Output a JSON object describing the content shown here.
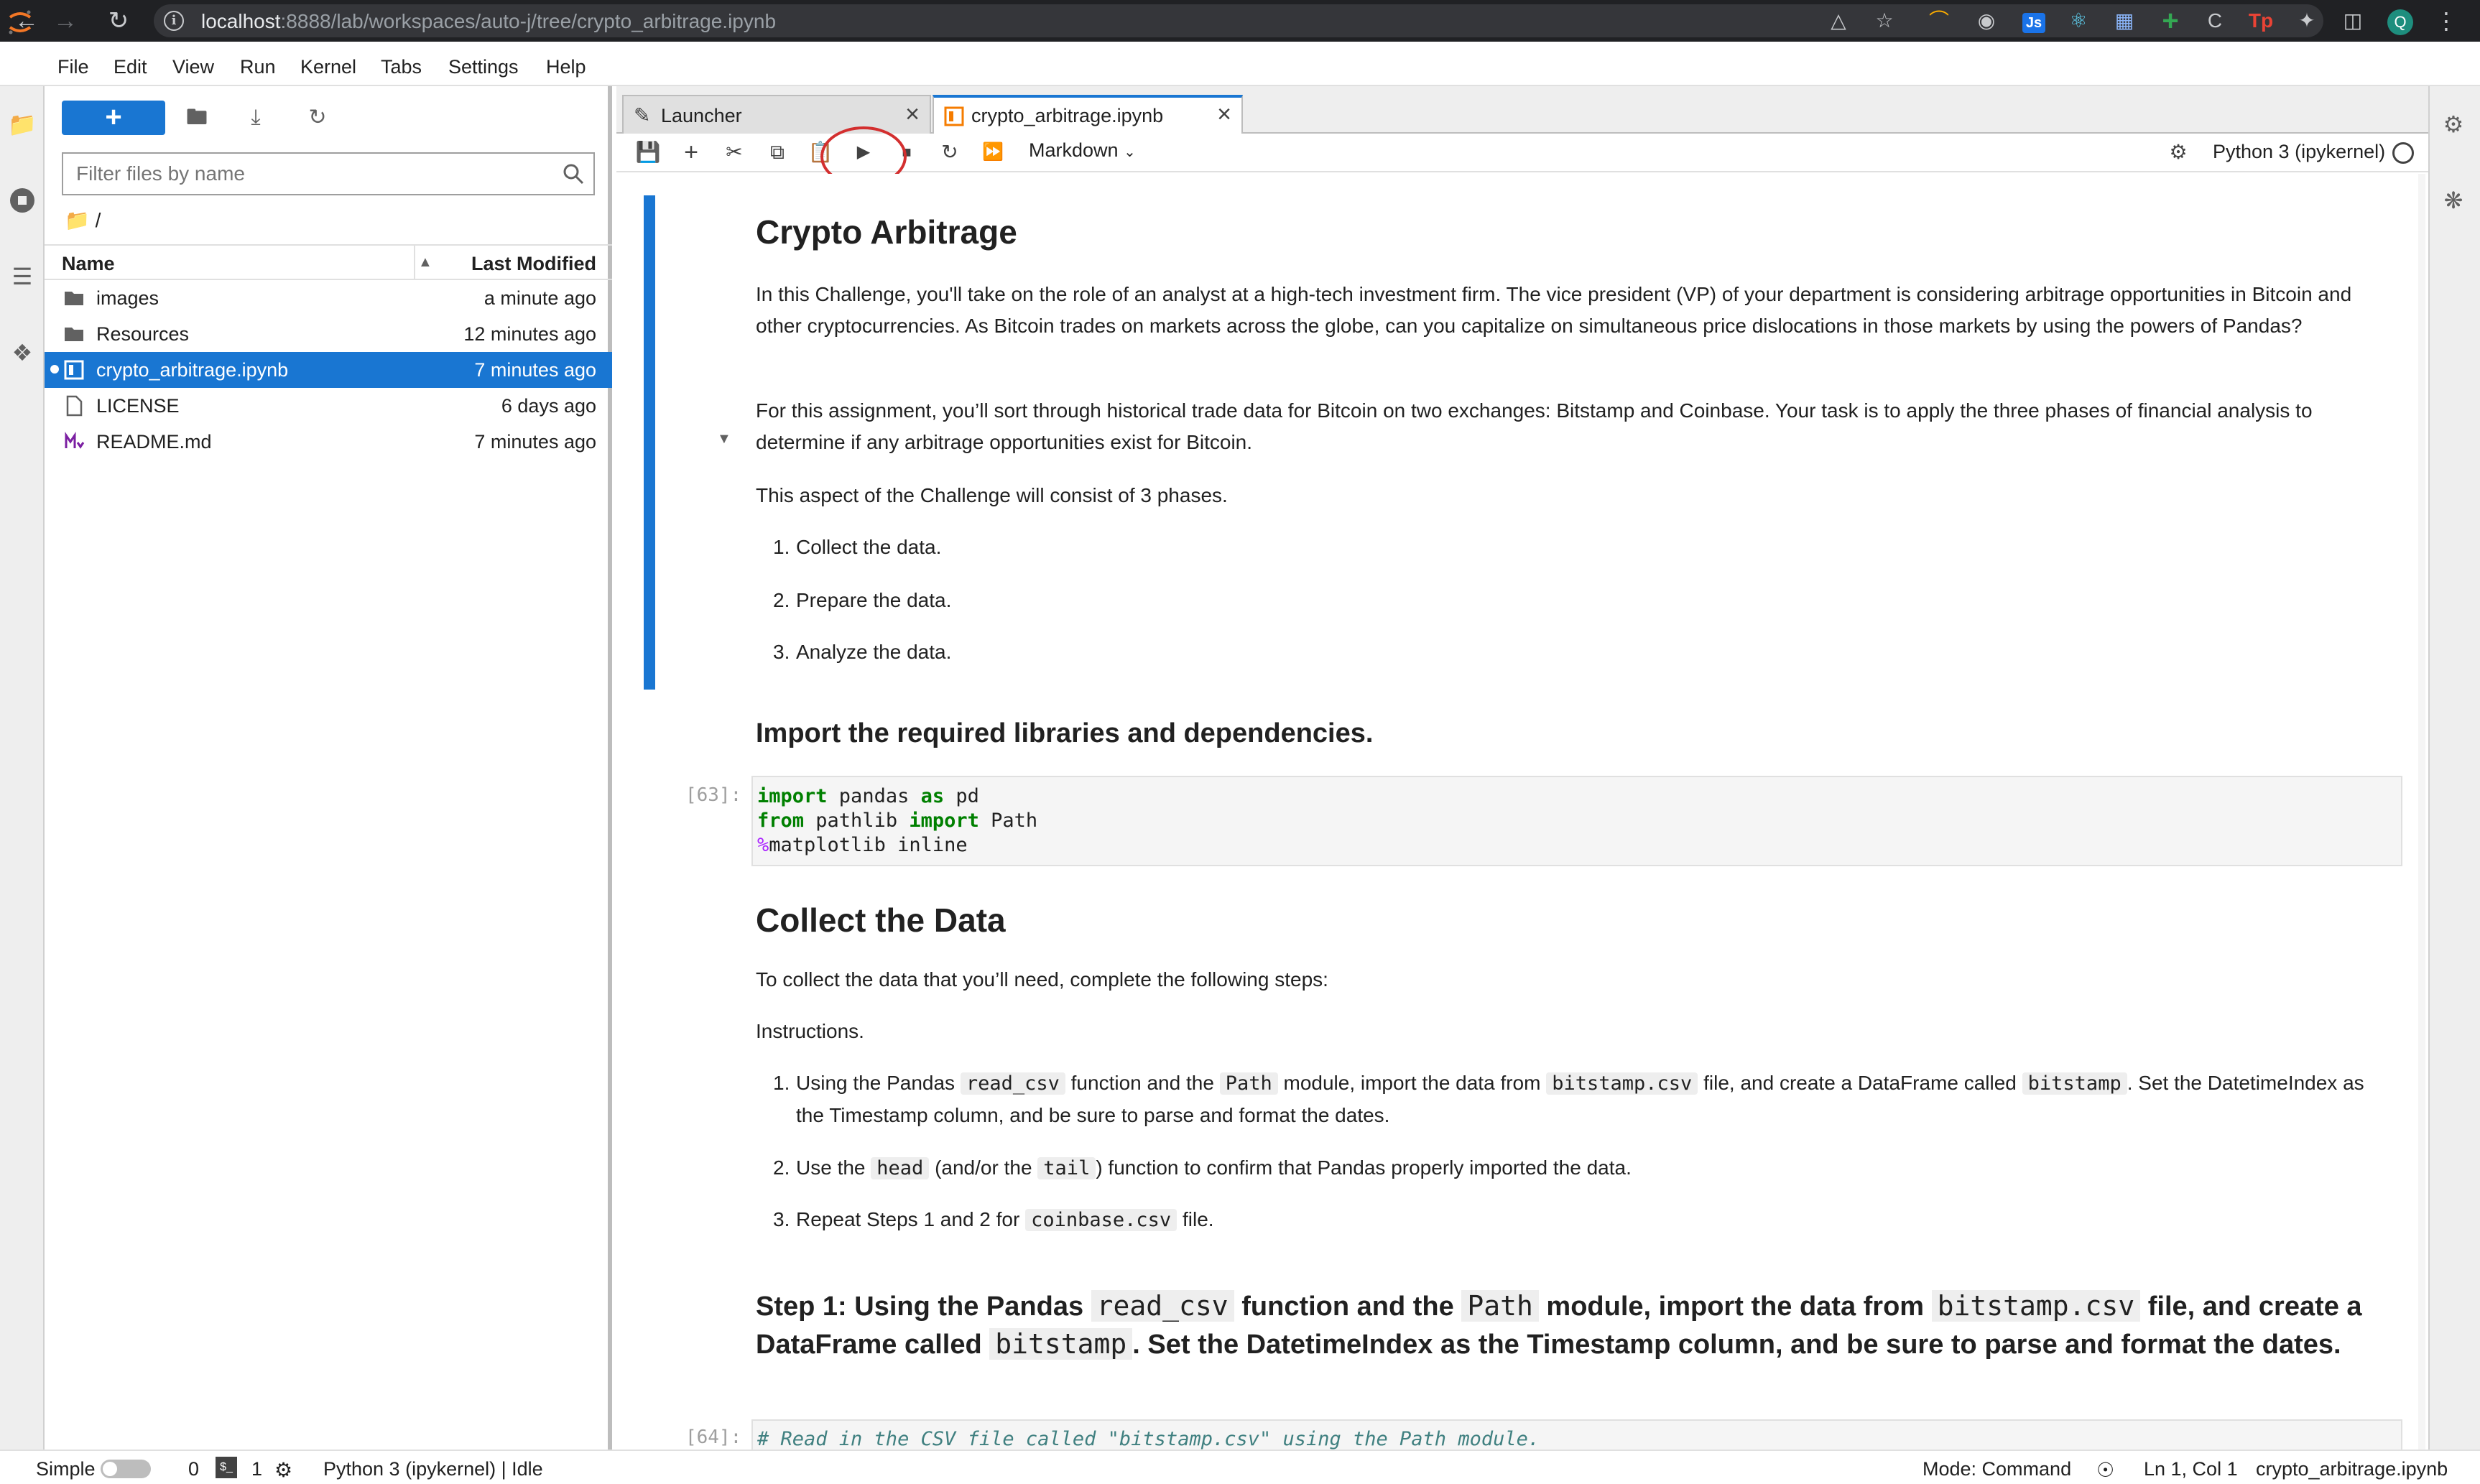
{
  "browser": {
    "url_host": "localhost",
    "url_rest": ":8888/lab/workspaces/auto-j/tree/crypto_arbitrage.ipynb"
  },
  "menu": [
    "File",
    "Edit",
    "View",
    "Run",
    "Kernel",
    "Tabs",
    "Settings",
    "Help"
  ],
  "filebrowser": {
    "filter_placeholder": "Filter files by name",
    "breadcrumb": "/",
    "col_name": "Name",
    "col_modified": "Last Modified",
    "files": [
      {
        "name": "images",
        "modified": "a minute ago"
      },
      {
        "name": "Resources",
        "modified": "12 minutes ago"
      },
      {
        "name": "crypto_arbitrage.ipynb",
        "modified": "7 minutes ago"
      },
      {
        "name": "LICENSE",
        "modified": "6 days ago"
      },
      {
        "name": "README.md",
        "modified": "7 minutes ago"
      }
    ]
  },
  "tabs": [
    {
      "label": "Launcher"
    },
    {
      "label": "crypto_arbitrage.ipynb"
    }
  ],
  "toolbar": {
    "cell_type": "Markdown",
    "kernel": "Python 3 (ipykernel)"
  },
  "notebook": {
    "title": "Crypto Arbitrage",
    "intro_p1": "In this Challenge, you'll take on the role of an analyst at a high-tech investment firm. The vice president (VP) of your department is considering arbitrage opportunities in Bitcoin and other cryptocurrencies. As Bitcoin trades on markets across the globe, can you capitalize on simultaneous price dislocations in those markets by using the powers of Pandas?",
    "intro_p2": "For this assignment, you’ll sort through historical trade data for Bitcoin on two exchanges: Bitstamp and Coinbase. Your task is to apply the three phases of financial analysis to determine if any arbitrage opportunities exist for Bitcoin.",
    "intro_p3": "This aspect of the Challenge will consist of 3 phases.",
    "phases": [
      "Collect the data.",
      "Prepare the data.",
      "Analyze the data."
    ],
    "import_heading": "Import the required libraries and dependencies.",
    "prompt1": "[63]:",
    "collect_heading": "Collect the Data",
    "collect_p1": "To collect the data that you’ll need, complete the following steps:",
    "collect_p2": "Instructions.",
    "inst1": {
      "a": "Using the Pandas ",
      "c1": "read_csv",
      "b": " function and the ",
      "c2": "Path",
      "c": " module, import the data from ",
      "c3": "bitstamp.csv",
      "d": " file, and create a DataFrame called ",
      "c4": "bitstamp",
      "e": ". Set the DatetimeIndex as the Timestamp column, and be sure to parse and format the dates."
    },
    "inst2": {
      "a": "Use the ",
      "c1": "head",
      "b": " (and/or the ",
      "c2": "tail",
      "c": ") function to confirm that Pandas properly imported the data."
    },
    "inst3": {
      "a": "Repeat Steps 1 and 2 for ",
      "c1": "coinbase.csv",
      "b": " file."
    },
    "step1": {
      "a": "Step 1: Using the Pandas ",
      "c1": "read_csv",
      "b": " function and the ",
      "c2": "Path",
      "c": " module, import the data from ",
      "c3": "bitstamp.csv",
      "d": " file, and create a DataFrame called ",
      "c4": "bitstamp",
      "e": ". Set the DatetimeIndex as the Timestamp column, and be sure to parse and format the dates."
    },
    "prompt2": "[64]:",
    "code2_comment": "# Read in the CSV file called \"bitstamp.csv\" using the Path module."
  },
  "status": {
    "mode_label": "Simple",
    "terminals": "0",
    "kernels": "1",
    "kernel_status": "Python 3 (ipykernel) | Idle",
    "mode": "Mode: Command",
    "position": "Ln 1, Col 1",
    "filename": "crypto_arbitrage.ipynb"
  }
}
